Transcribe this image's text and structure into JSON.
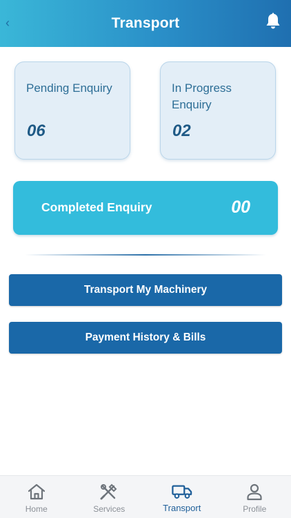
{
  "header": {
    "title": "Transport",
    "back_glyph": "‹",
    "notification_icon": "bell-icon"
  },
  "stats": {
    "pending": {
      "label": "Pending Enquiry",
      "value": "06"
    },
    "in_progress": {
      "label": "In Progress Enquiry",
      "value": "02"
    },
    "completed": {
      "label": "Completed Enquiry",
      "value": "00"
    }
  },
  "actions": {
    "transport_label": "Transport My Machinery",
    "payment_label": "Payment History & Bills"
  },
  "bottom_nav": {
    "items": [
      {
        "label": "Home",
        "icon": "home-icon"
      },
      {
        "label": "Services",
        "icon": "tools-icon"
      },
      {
        "label": "Transport",
        "icon": "truck-icon",
        "active": true
      },
      {
        "label": "Profile",
        "icon": "person-icon"
      }
    ]
  },
  "colors": {
    "header_start": "#3ab7d8",
    "header_end": "#1f6fb0",
    "card_bg": "#e3eef7",
    "completed_bg": "#33bcdc",
    "button_bg": "#1a68a8",
    "active_nav": "#1f5f99",
    "inactive_nav": "#8a8f96"
  }
}
